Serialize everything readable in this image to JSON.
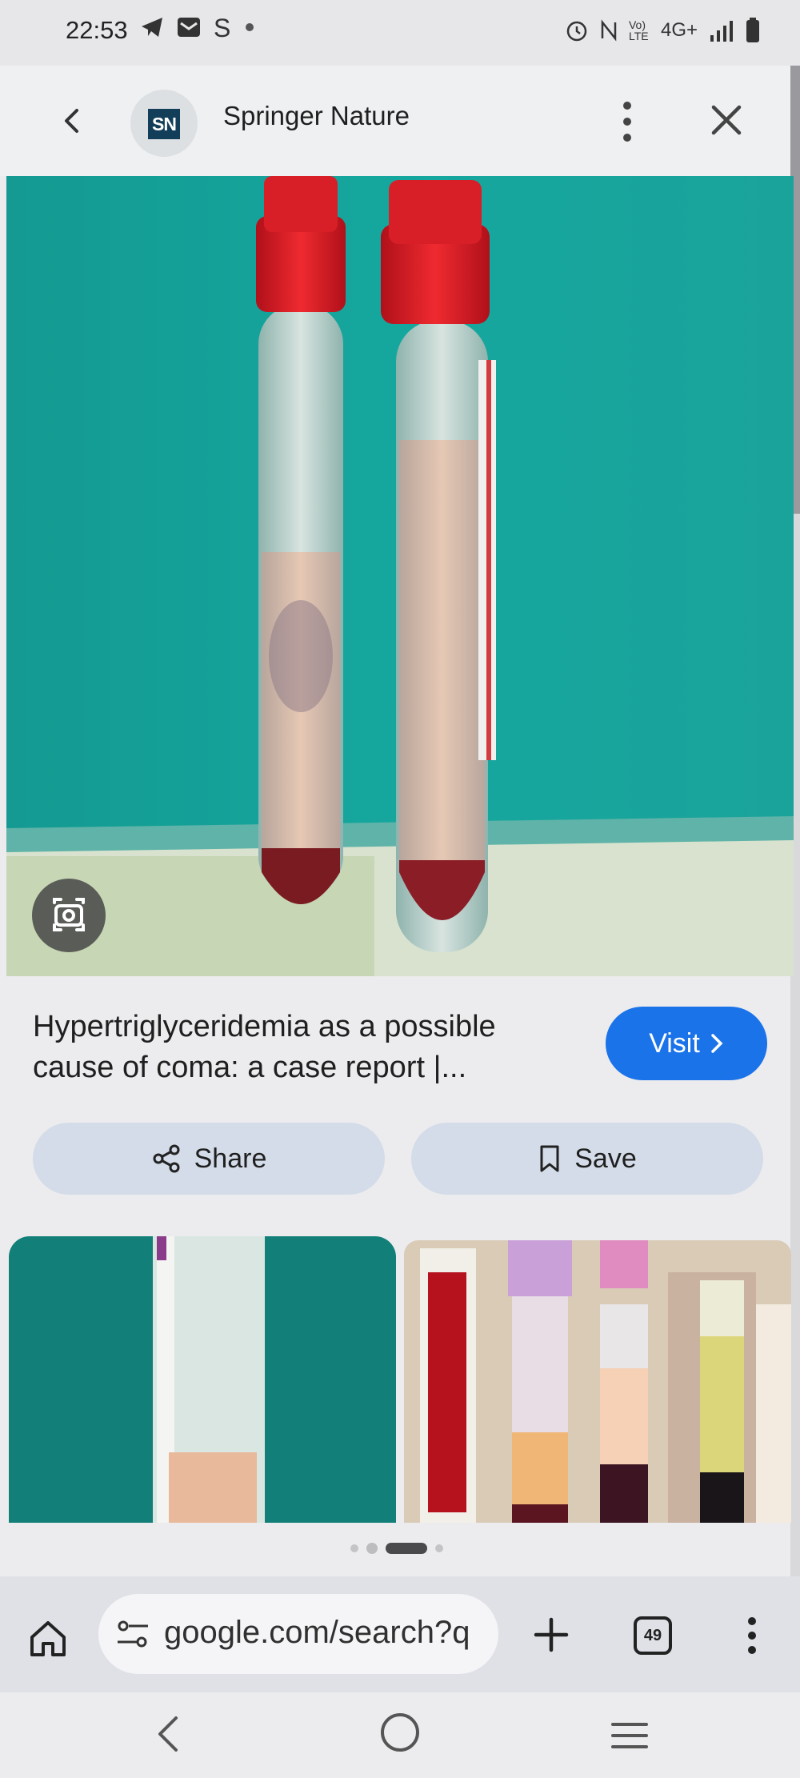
{
  "status_bar": {
    "time": "22:53",
    "left_icons": [
      "telegram-icon",
      "mail-icon",
      "skype-icon",
      "dot-icon"
    ],
    "network_label": "4G+",
    "volte_label": "Vo) LTE",
    "right_icons": [
      "alarm-icon",
      "nfc-icon",
      "volte-icon",
      "signal-icon",
      "battery-icon"
    ]
  },
  "header": {
    "back_icon": "chevron-left-icon",
    "logo_text": "SN",
    "site_name": "Springer Nature",
    "menu_icon": "kebab-menu-icon",
    "close_icon": "close-icon"
  },
  "result": {
    "title": "Hypertriglyceridemia as a possible cause of coma: a case report |...",
    "visit_label": "Visit",
    "share_label": "Share",
    "save_label": "Save"
  },
  "carousel": {
    "total_pages": 4,
    "active_page": 3
  },
  "toolbar": {
    "url": "google.com/search?q",
    "tab_count": "49"
  },
  "colors": {
    "accent": "#1a73e8",
    "pill_bg": "#d3dce8",
    "background": "#ececee"
  }
}
